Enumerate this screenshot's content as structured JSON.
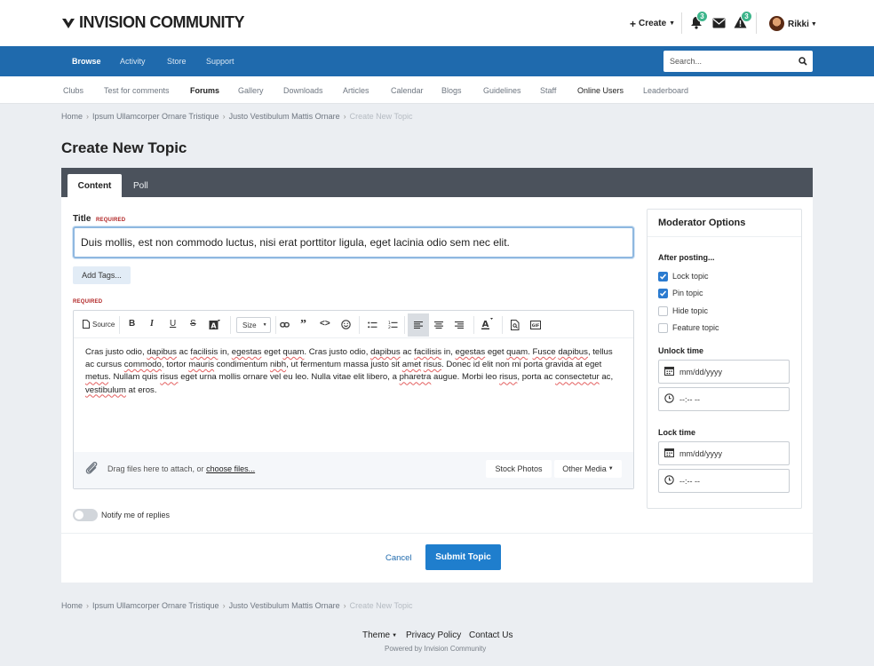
{
  "header": {
    "logo_text": "INVISION COMMUNITY",
    "create_label": "Create",
    "notifications_count": "3",
    "reports_count": "3",
    "username": "Rikki"
  },
  "nav": {
    "items": [
      "Browse",
      "Activity",
      "Store",
      "Support"
    ],
    "search_placeholder": "Search..."
  },
  "subnav": {
    "items": [
      "Clubs",
      "Test for comments",
      "Forums",
      "Gallery",
      "Downloads",
      "Articles",
      "Calendar",
      "Blogs",
      "Guidelines",
      "Staff",
      "Online Users",
      "Leaderboard"
    ]
  },
  "breadcrumb": [
    "Home",
    "Ipsum Ullamcorper Ornare Tristique",
    "Justo Vestibulum Mattis Ornare",
    "Create New Topic"
  ],
  "page": {
    "title": "Create New Topic"
  },
  "tabs": [
    "Content",
    "Poll"
  ],
  "form": {
    "title_label": "Title",
    "required_label": "REQUIRED",
    "title_value": "Duis mollis, est non commodo luctus, nisi erat porttitor ligula, eget lacinia odio sem nec elit.",
    "add_tags_label": "Add Tags...",
    "toolbar_source_label": "Source",
    "toolbar_size_label": "Size",
    "body_segments": [
      "Cras justo odio, ",
      "dapibus",
      " ac ",
      "facilisis",
      " in, ",
      "egestas",
      " eget ",
      "quam",
      ". Cras justo odio, ",
      "dapibus",
      " ac ",
      "facilisis",
      " in, ",
      "egestas",
      " eget ",
      "quam",
      ". ",
      "Fusce",
      " ",
      "dapibus",
      ", tellus ac cursus ",
      "commodo",
      ", tortor ",
      "mauris",
      " condimentum ",
      "nibh",
      ", ut fermentum massa justo sit ",
      "amet",
      " ",
      "risus",
      ". Donec id elit non mi porta gravida at eget ",
      "metus",
      ". Nullam quis ",
      "risus",
      " eget urna mollis ornare vel eu leo. Nulla vitae elit libero, a ",
      "pharetra",
      " augue. Morbi leo ",
      "risus",
      ", porta ac ",
      "consectetur",
      " ac, ",
      "vestibulum",
      " at eros."
    ],
    "attach_text": "Drag files here to attach, or",
    "attach_link": "choose files...",
    "stock_photos_label": "Stock Photos",
    "other_media_label": "Other Media",
    "notify_label": "Notify me of replies",
    "cancel_label": "Cancel",
    "submit_label": "Submit Topic"
  },
  "moderator": {
    "title": "Moderator Options",
    "after_posting_label": "After posting...",
    "options": [
      {
        "label": "Lock topic",
        "checked": true
      },
      {
        "label": "Pin topic",
        "checked": true
      },
      {
        "label": "Hide topic",
        "checked": false
      },
      {
        "label": "Feature topic",
        "checked": false
      }
    ],
    "unlock_time_label": "Unlock time",
    "lock_time_label": "Lock time",
    "date_placeholder": "mm/dd/yyyy",
    "time_placeholder": "--:-- --"
  },
  "footer": {
    "theme_label": "Theme",
    "privacy_label": "Privacy Policy",
    "contact_label": "Contact Us",
    "powered_by": "Powered by Invision Community"
  },
  "colors": {
    "brand_blue": "#1f6aad",
    "submit_blue": "#1f7ecd",
    "tab_bar": "#4b525c",
    "badge_green": "#3db58b",
    "required_red": "#b12525"
  }
}
